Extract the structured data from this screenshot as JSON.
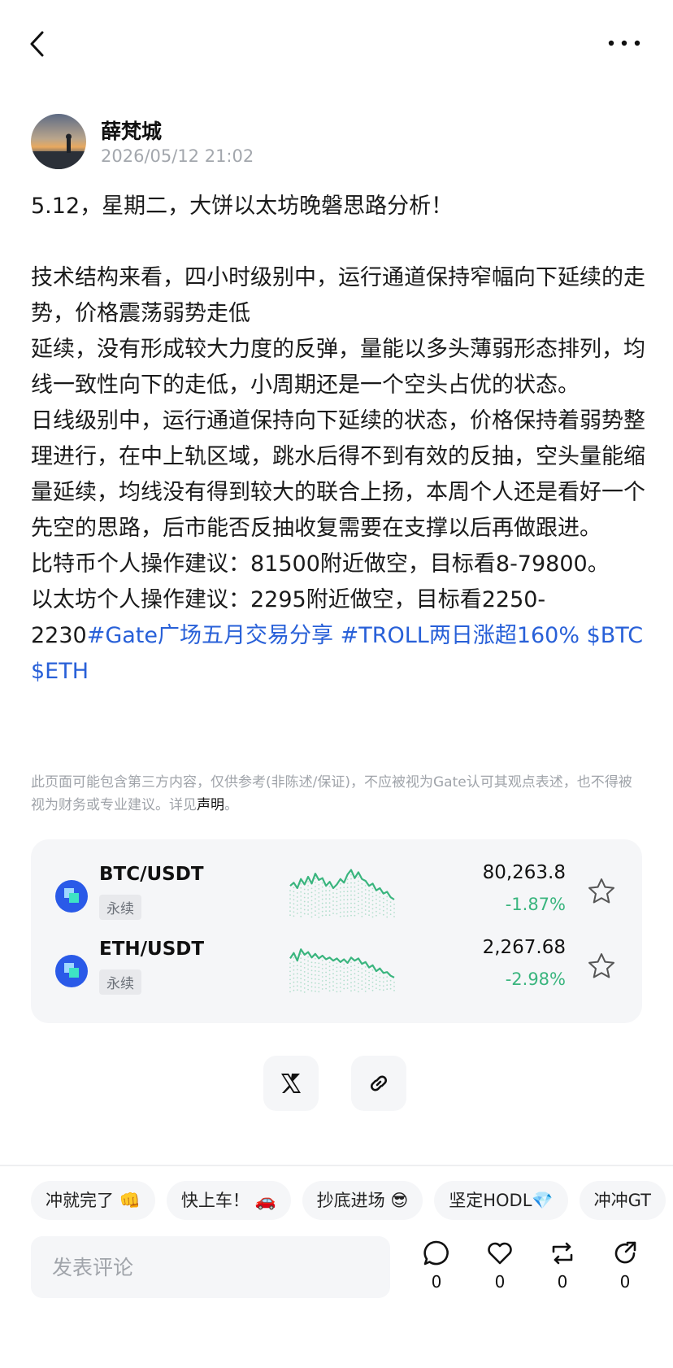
{
  "author": {
    "name": "薛梵城",
    "time": "2026/05/12 21:02"
  },
  "post": {
    "title_line": "5.12，星期二，大饼以太坊晚磐思路分析！",
    "paragraph1": "技术结构来看，四小时级别中，运行通道保持窄幅向下延续的走势，价格震荡弱势走低",
    "paragraph2": "延续，没有形成较大力度的反弹，量能以多头薄弱形态排列，均线一致性向下的走低，小周期还是一个空头占优的状态。",
    "paragraph3": "日线级别中，运行通道保持向下延续的状态，价格保持着弱势整理进行，在中上轨区域，跳水后得不到有效的反抽，空头量能缩量延续，均线没有得到较大的联合上扬，本周个人还是看好一个先空的思路，后市能否反抽收复需要在支撑以后再做跟进。",
    "btc_advice": "比特币个人操作建议：81500附近做空，目标看8-79800。",
    "eth_advice": "以太坊个人操作建议：2295附近做空，目标看2250-2230",
    "tag1": "#Gate广场五月交易分享",
    "tag2": "#TROLL两日涨超160%",
    "tag3": "$BTC",
    "tag4": "$ETH"
  },
  "disclaimer": {
    "text": "此页面可能包含第三方内容，仅供参考(非陈述/保证)，不应被视为Gate认可其观点表述，也不得被视为财务或专业建议。详见",
    "link": "声明",
    "end": "。"
  },
  "markets": [
    {
      "pair": "BTC/USDT",
      "type": "永续",
      "price": "80,263.8",
      "change": "-1.87%",
      "spark": [
        0.55,
        0.62,
        0.5,
        0.7,
        0.58,
        0.75,
        0.6,
        0.82,
        0.68,
        0.72,
        0.55,
        0.64,
        0.5,
        0.58,
        0.7,
        0.62,
        0.8,
        0.9,
        0.72,
        0.85,
        0.7,
        0.66,
        0.55,
        0.6,
        0.45,
        0.5,
        0.38,
        0.42,
        0.3,
        0.25
      ],
      "star_icon": "star-icon"
    },
    {
      "pair": "ETH/USDT",
      "type": "永续",
      "price": "2,267.68",
      "change": "-2.98%",
      "spark": [
        0.6,
        0.72,
        0.55,
        0.8,
        0.68,
        0.74,
        0.62,
        0.7,
        0.6,
        0.66,
        0.58,
        0.62,
        0.55,
        0.6,
        0.52,
        0.58,
        0.5,
        0.62,
        0.55,
        0.6,
        0.48,
        0.52,
        0.4,
        0.45,
        0.32,
        0.38,
        0.28,
        0.3,
        0.22,
        0.18
      ],
      "star_icon": "star-icon"
    }
  ],
  "chips": [
    "冲就完了 👊",
    "快上车！ 🚗",
    "抄底进场 😎",
    "坚定HODL💎",
    "冲冲GT"
  ],
  "comment": {
    "placeholder": "发表评论"
  },
  "actions": {
    "comment_count": "0",
    "like_count": "0",
    "repost_count": "0",
    "share_count": "0"
  },
  "colors": {
    "accent": "#2860d8",
    "up_down_green": "#3ab57e",
    "card_bg": "#f5f6f8"
  }
}
